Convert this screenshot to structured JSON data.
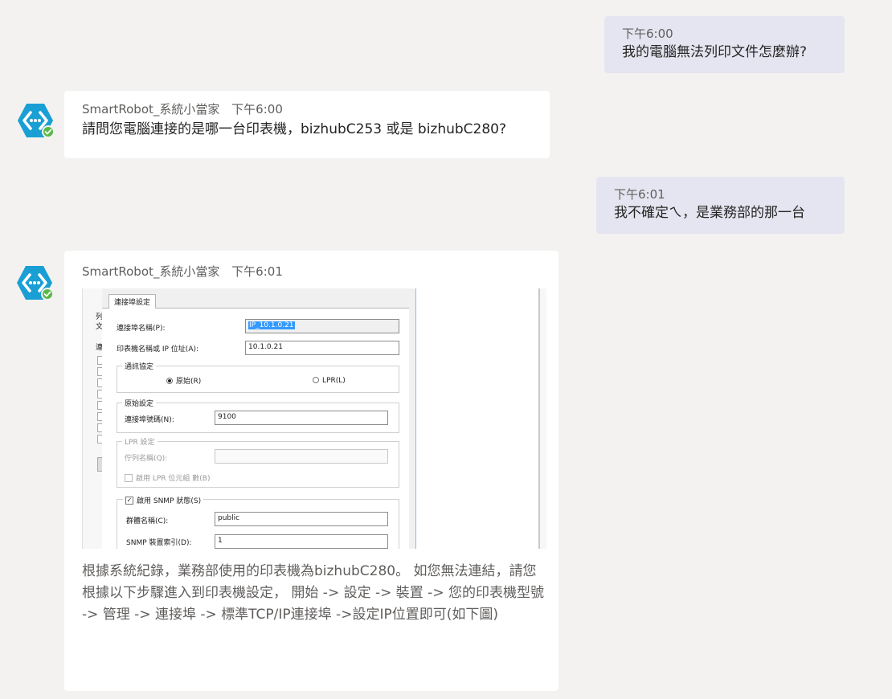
{
  "messages": [
    {
      "id": "u1",
      "role": "user",
      "time": "下午6:00",
      "text": "我的電腦無法列印文件怎麼辦?"
    },
    {
      "id": "b1",
      "role": "bot",
      "sender": "SmartRobot_系統小當家",
      "time": "下午6:00",
      "text": "請問您電腦連接的是哪一台印表機，bizhubC253 或是 bizhubC280?"
    },
    {
      "id": "u2",
      "role": "user",
      "time": "下午6:01",
      "text": "我不確定ㄟ，是業務部的那一台"
    },
    {
      "id": "b2",
      "role": "bot",
      "sender": "SmartRobot_系統小當家",
      "time": "下午6:01",
      "text": "根據系統紀錄，業務部使用的印表機為bizhubC280。 如您無法連結，請您根據以下步驟進入到印表機設定， 開始 -> 設定 -> 裝置 -> 您的印表機型號 -> 管理 -> 連接埠 -> 標準TCP/IP連接埠 ->設定IP位置即可(如下圖)"
    }
  ],
  "dialog": {
    "tab": "連接埠設定",
    "port_name_label": "連接埠名稱(P):",
    "port_name_value": "IP_10.1.0.21",
    "printer_ip_label": "印表機名稱或 IP 位址(A):",
    "printer_ip_value": "10.1.0.21",
    "protocol_group": "通訊協定",
    "raw_option": "原始(R)",
    "lpr_option": "LPR(L)",
    "raw_group": "原始設定",
    "port_number_label": "連接埠號碼(N):",
    "port_number_value": "9100",
    "lpr_group": "LPR 設定",
    "queue_name_label": "佇列名稱(Q):",
    "lpr_byte_count_label": "啟用 LPR 位元組 數(B)",
    "snmp_label": "啟用 SNMP 狀態(S)",
    "community_label": "群體名稱(C):",
    "community_value": "public",
    "snmp_index_label": "SNMP 裝置索引(D):",
    "snmp_index_value": "1",
    "left_fragments": [
      "列",
      "文",
      "連"
    ]
  },
  "colors": {
    "background": "#f3f2f1",
    "user_bubble": "#e5e5f1",
    "bot_bubble": "#ffffff",
    "avatar": "#1a9fd4",
    "status_dot": "#58b947"
  }
}
